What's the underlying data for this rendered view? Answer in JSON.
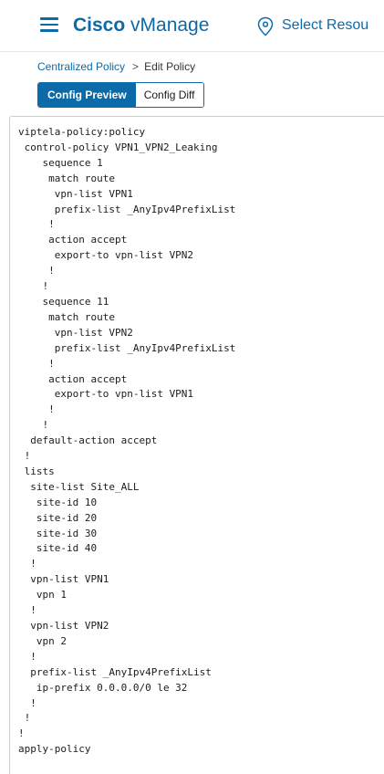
{
  "header": {
    "brand_bold": "Cisco",
    "brand_light": " vManage",
    "select_resource": "Select Resou",
    "menu_icon": "hamburger-icon",
    "location_icon": "map-pin-icon",
    "accent_color": "#0d6aa8"
  },
  "breadcrumb": {
    "parent": "Centralized Policy",
    "separator": ">",
    "current": "Edit Policy"
  },
  "tabs": {
    "config_preview": "Config Preview",
    "config_diff": "Config Diff",
    "active": "Config Preview"
  },
  "config_text": "viptela-policy:policy\n control-policy VPN1_VPN2_Leaking\n    sequence 1\n     match route\n      vpn-list VPN1\n      prefix-list _AnyIpv4PrefixList\n     !\n     action accept\n      export-to vpn-list VPN2\n     !\n    !\n    sequence 11\n     match route\n      vpn-list VPN2\n      prefix-list _AnyIpv4PrefixList\n     !\n     action accept\n      export-to vpn-list VPN1\n     !\n    !\n  default-action accept\n !\n lists\n  site-list Site_ALL\n   site-id 10\n   site-id 20\n   site-id 30\n   site-id 40\n  !\n  vpn-list VPN1\n   vpn 1\n  !\n  vpn-list VPN2\n   vpn 2\n  !\n  prefix-list _AnyIpv4PrefixList\n   ip-prefix 0.0.0.0/0 le 32\n  !\n !\n!\napply-policy"
}
